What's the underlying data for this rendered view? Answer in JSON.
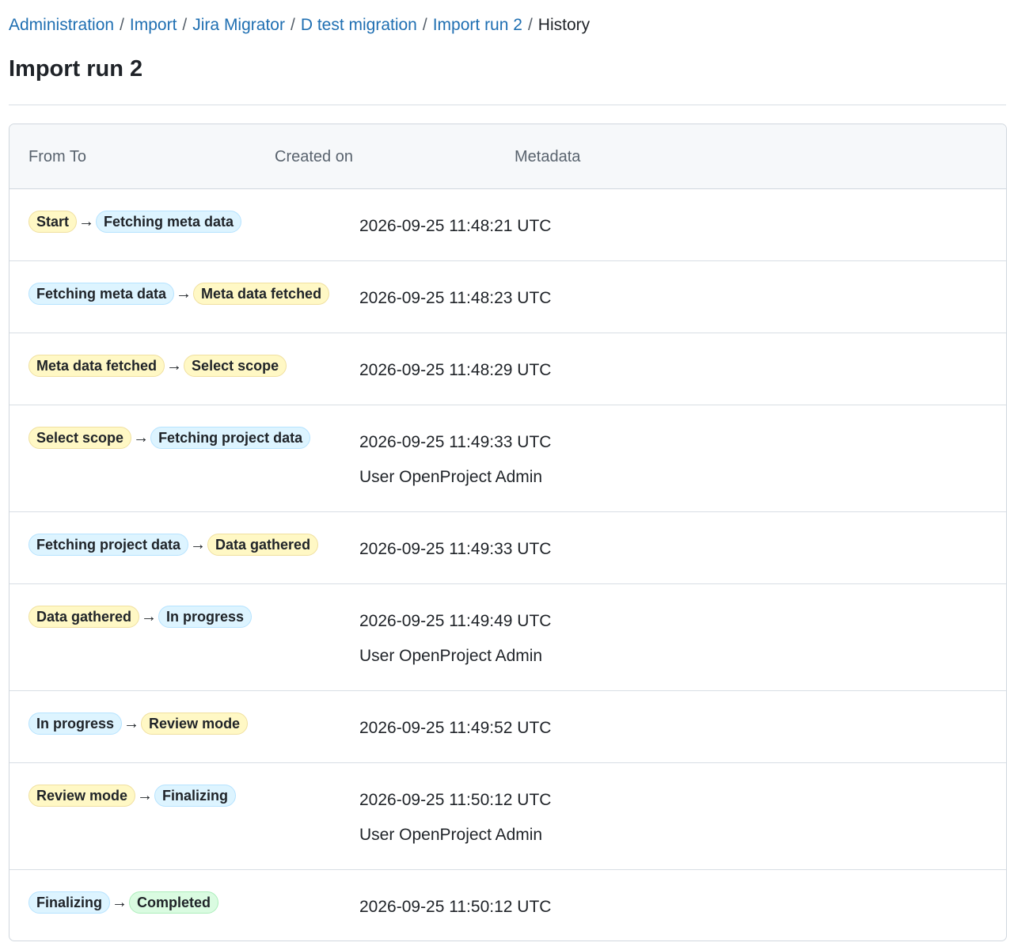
{
  "breadcrumb": {
    "items": [
      "Administration",
      "Import",
      "Jira Migrator",
      "D test migration",
      "Import run 2"
    ],
    "current": "History",
    "separator": "/"
  },
  "page": {
    "title": "Import run 2"
  },
  "table": {
    "headers": {
      "from_to": "From To",
      "created_on": "Created on",
      "metadata": "Metadata"
    },
    "rows": [
      {
        "from": "Start",
        "from_color": "yellow",
        "to": "Fetching meta data",
        "to_color": "blue",
        "created": "2026-09-25 11:48:21 UTC",
        "user": ""
      },
      {
        "from": "Fetching meta data",
        "from_color": "blue",
        "to": "Meta data fetched",
        "to_color": "yellow",
        "created": "2026-09-25 11:48:23 UTC",
        "user": ""
      },
      {
        "from": "Meta data fetched",
        "from_color": "yellow",
        "to": "Select scope",
        "to_color": "yellow",
        "created": "2026-09-25 11:48:29 UTC",
        "user": ""
      },
      {
        "from": "Select scope",
        "from_color": "yellow",
        "to": "Fetching project data",
        "to_color": "blue",
        "created": "2026-09-25 11:49:33 UTC",
        "user": "User OpenProject Admin"
      },
      {
        "from": "Fetching project data",
        "from_color": "blue",
        "to": "Data gathered",
        "to_color": "yellow",
        "created": "2026-09-25 11:49:33 UTC",
        "user": ""
      },
      {
        "from": "Data gathered",
        "from_color": "yellow",
        "to": "In progress",
        "to_color": "blue",
        "created": "2026-09-25 11:49:49 UTC",
        "user": "User OpenProject Admin"
      },
      {
        "from": "In progress",
        "from_color": "blue",
        "to": "Review mode",
        "to_color": "yellow",
        "created": "2026-09-25 11:49:52 UTC",
        "user": ""
      },
      {
        "from": "Review mode",
        "from_color": "yellow",
        "to": "Finalizing",
        "to_color": "blue",
        "created": "2026-09-25 11:50:12 UTC",
        "user": "User OpenProject Admin"
      },
      {
        "from": "Finalizing",
        "from_color": "blue",
        "to": "Completed",
        "to_color": "green",
        "created": "2026-09-25 11:50:12 UTC",
        "user": ""
      }
    ]
  },
  "colors": {
    "link": "#1f6fb2",
    "yellow_pill": "#fff8c5",
    "blue_pill": "#ddf4ff",
    "green_pill": "#dafbe1"
  }
}
